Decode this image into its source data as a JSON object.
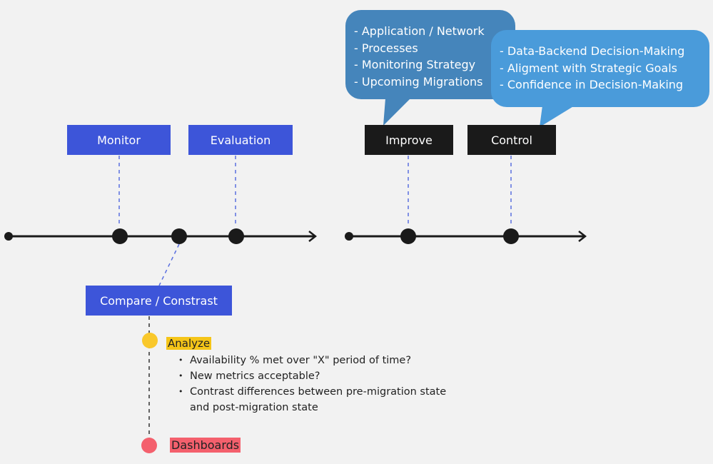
{
  "colors": {
    "background": "#f2f2f2",
    "phase_blue": "#3d55d9",
    "phase_black": "#1a1a1a",
    "bubble_dark": "#4585bb",
    "bubble_light": "#4a9bda",
    "analyze_highlight": "#f5c518",
    "dashboards_highlight": "#f4606d"
  },
  "phases": {
    "monitor": "Monitor",
    "evaluation": "Evaluation",
    "compare": "Compare / Constrast",
    "improve": "Improve",
    "control": "Control"
  },
  "callouts": {
    "improve": [
      "- Application / Network",
      "- Processes",
      "- Monitoring Strategy",
      "- Upcoming Migrations"
    ],
    "control": [
      "- Data-Backend Decision-Making",
      "- Aligment with Strategic Goals",
      "- Confidence in Decision-Making"
    ]
  },
  "analyze": {
    "label": "Analyze",
    "bullets": [
      "Availability % met over \"X\" period of time?",
      "New metrics acceptable?",
      "Contrast differences between pre-migration state and post-migration state"
    ]
  },
  "dashboards": {
    "label": "Dashboards"
  }
}
